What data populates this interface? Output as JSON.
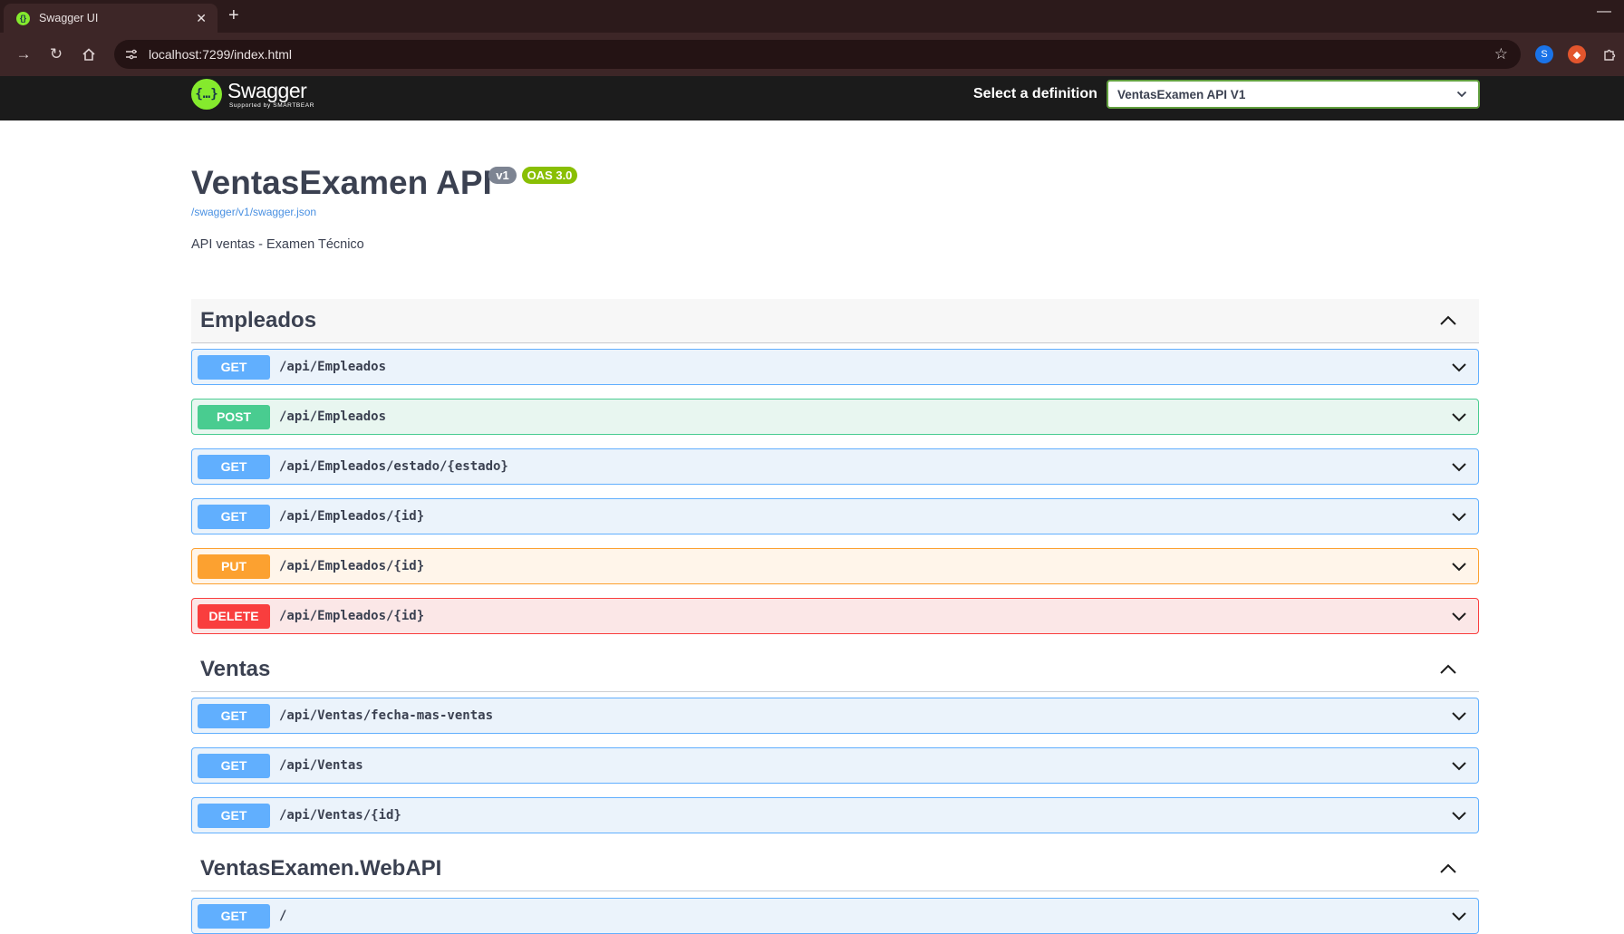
{
  "browser": {
    "tab_title": "Swagger UI",
    "url": "localhost:7299/index.html"
  },
  "topbar": {
    "logo_name": "Swagger",
    "logo_sub": "Supported by SMARTBEAR",
    "definition_label": "Select a definition",
    "definition_value": "VentasExamen API V1"
  },
  "info": {
    "title": "VentasExamen API",
    "version_badge": "v1",
    "oas_badge": "OAS 3.0",
    "spec_url": "/swagger/v1/swagger.json",
    "description": "API ventas - Examen Técnico"
  },
  "tags": [
    {
      "name": "Empleados",
      "operations": [
        {
          "method": "GET",
          "path": "/api/Empleados"
        },
        {
          "method": "POST",
          "path": "/api/Empleados"
        },
        {
          "method": "GET",
          "path": "/api/Empleados/estado/{estado}"
        },
        {
          "method": "GET",
          "path": "/api/Empleados/{id}"
        },
        {
          "method": "PUT",
          "path": "/api/Empleados/{id}"
        },
        {
          "method": "DELETE",
          "path": "/api/Empleados/{id}"
        }
      ]
    },
    {
      "name": "Ventas",
      "operations": [
        {
          "method": "GET",
          "path": "/api/Ventas/fecha-mas-ventas"
        },
        {
          "method": "GET",
          "path": "/api/Ventas"
        },
        {
          "method": "GET",
          "path": "/api/Ventas/{id}"
        }
      ]
    },
    {
      "name": "VentasExamen.WebAPI",
      "operations": [
        {
          "method": "GET",
          "path": "/"
        }
      ]
    }
  ],
  "colors": {
    "get": "#61affe",
    "post": "#49cc90",
    "put": "#fca130",
    "delete": "#f93e3e",
    "swagger_green": "#85ea2d"
  }
}
